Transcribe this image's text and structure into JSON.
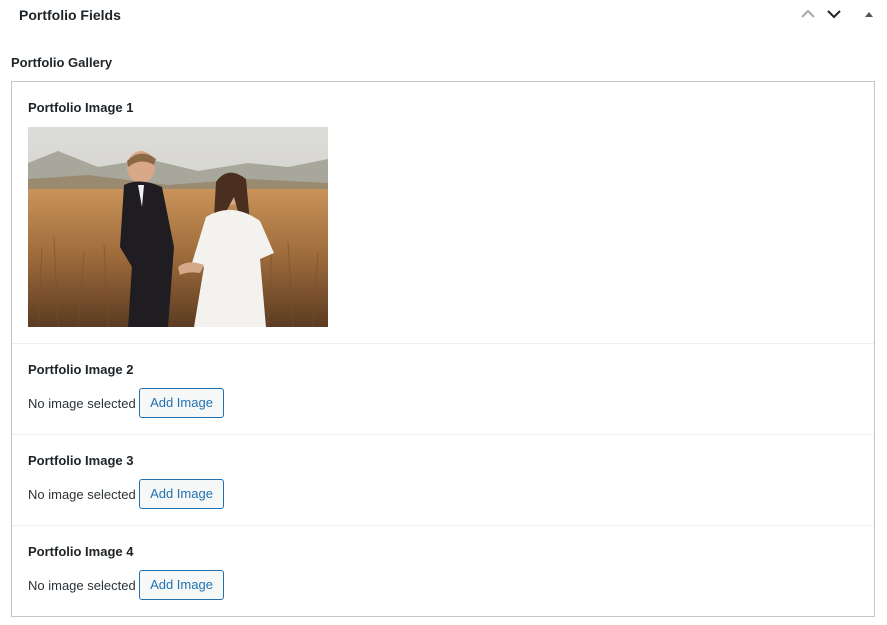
{
  "metabox": {
    "title": "Portfolio Fields",
    "icons": {
      "move_up": "chevron-up-icon",
      "move_down": "chevron-down-icon",
      "toggle": "triangle-up-icon"
    }
  },
  "gallery": {
    "label": "Portfolio Gallery",
    "fields": [
      {
        "label": "Portfolio Image 1",
        "has_image": true,
        "image_description": "couple-in-field-photo"
      },
      {
        "label": "Portfolio Image 2",
        "has_image": false,
        "status": "No image selected",
        "button": "Add Image"
      },
      {
        "label": "Portfolio Image 3",
        "has_image": false,
        "status": "No image selected",
        "button": "Add Image"
      },
      {
        "label": "Portfolio Image 4",
        "has_image": false,
        "status": "No image selected",
        "button": "Add Image"
      }
    ]
  },
  "colors": {
    "accent": "#2271b1",
    "border": "#c3c4c7",
    "divider": "#f0f0f1",
    "text": "#1d2327"
  }
}
